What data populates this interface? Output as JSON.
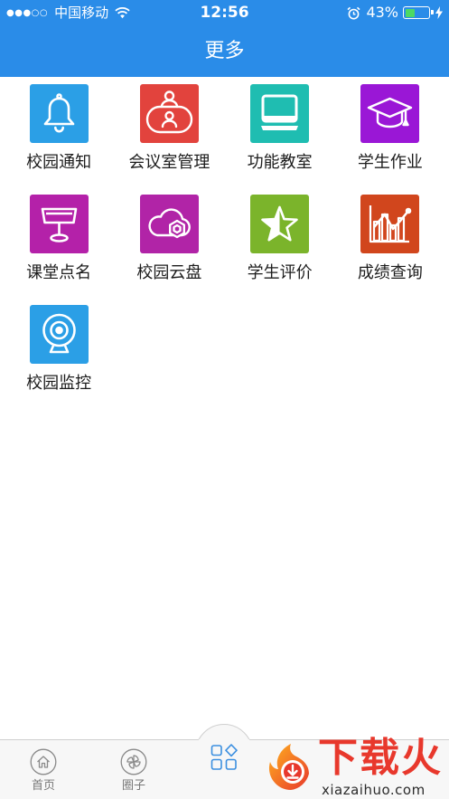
{
  "theme": {
    "primary": "#2a8ce8",
    "battery_fill": "#4cd964",
    "watermark_red": "#e8382c",
    "center_tab_color": "#3b8fe0"
  },
  "status_bar": {
    "signal": "●●●○○",
    "carrier": "中国移动",
    "time": "12:56",
    "battery_text": "43%",
    "battery_level": 0.43,
    "icons": [
      "wifi-icon",
      "alarm-icon",
      "battery-icon",
      "charging-icon"
    ]
  },
  "header": {
    "title": "更多"
  },
  "apps": [
    {
      "label": "校园通知",
      "icon": "bell-icon",
      "color": "#2b9fe6"
    },
    {
      "label": "会议室管理",
      "icon": "meeting-room-icon",
      "color": "#e2433d"
    },
    {
      "label": "功能教室",
      "icon": "monitor-icon",
      "color": "#1fbdb1"
    },
    {
      "label": "学生作业",
      "icon": "graduation-cap-icon",
      "color": "#9a17d6"
    },
    {
      "label": "课堂点名",
      "icon": "lamp-icon",
      "color": "#b421a9"
    },
    {
      "label": "校园云盘",
      "icon": "cloud-drive-icon",
      "color": "#b124a7"
    },
    {
      "label": "学生评价",
      "icon": "star-icon",
      "color": "#7bb42b"
    },
    {
      "label": "成绩查询",
      "icon": "chart-icon",
      "color": "#d1461d"
    },
    {
      "label": "校园监控",
      "icon": "webcam-icon",
      "color": "#2b9fe6"
    }
  ],
  "tab_bar": {
    "tabs": [
      {
        "label": "首页",
        "icon": "home-icon"
      },
      {
        "label": "圈子",
        "icon": "pinwheel-icon"
      }
    ],
    "center_icon": "grid-icon"
  },
  "watermark": {
    "brand": "下载火",
    "url": "xiazaihuo.com"
  }
}
